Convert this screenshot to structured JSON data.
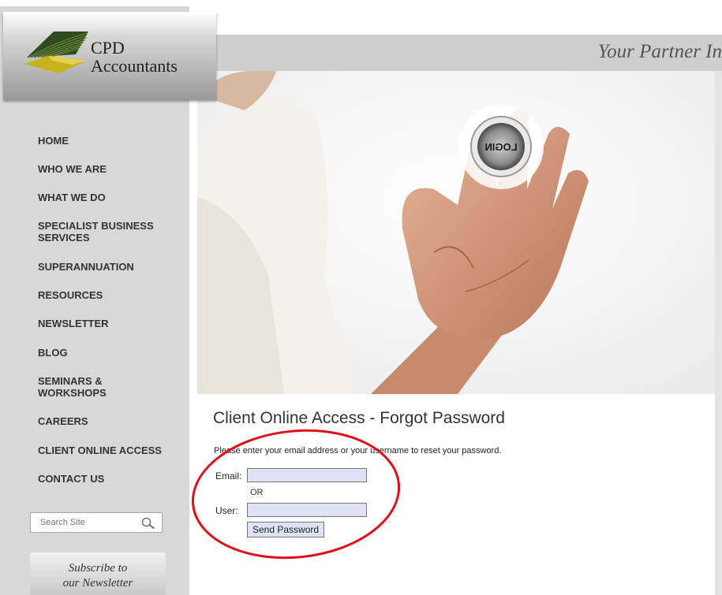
{
  "brand": {
    "logo_line1": "CPD",
    "logo_line2": "Accountants",
    "tagline": "Your Partner In"
  },
  "hero": {
    "button_text": "LOGIN"
  },
  "nav": {
    "items": [
      "HOME",
      "WHO WE ARE",
      "WHAT WE DO",
      "SPECIALIST BUSINESS SERVICES",
      "SUPERANNUATION",
      "RESOURCES",
      "NEWSLETTER",
      "BLOG",
      "SEMINARS & WORKSHOPS",
      "CAREERS",
      "CLIENT ONLINE ACCESS",
      "CONTACT US"
    ]
  },
  "search": {
    "placeholder": "Search Site",
    "icon": "magnifier-icon"
  },
  "subscribe": {
    "line1": "Subscribe to",
    "line2": "our Newsletter"
  },
  "main": {
    "title": "Client Online Access - Forgot Password",
    "instructions": "Please enter your email address or your username to reset your password.",
    "email_label": "Email:",
    "email_value": "",
    "or_text": "OR",
    "user_label": "User:",
    "user_value": "",
    "submit_label": "Send Password"
  },
  "colors": {
    "sidebar_bg": "#d8d8d8",
    "banner_bg": "#cfcfcf",
    "input_bg": "#dde3f4",
    "annotation": "#e0101a"
  }
}
